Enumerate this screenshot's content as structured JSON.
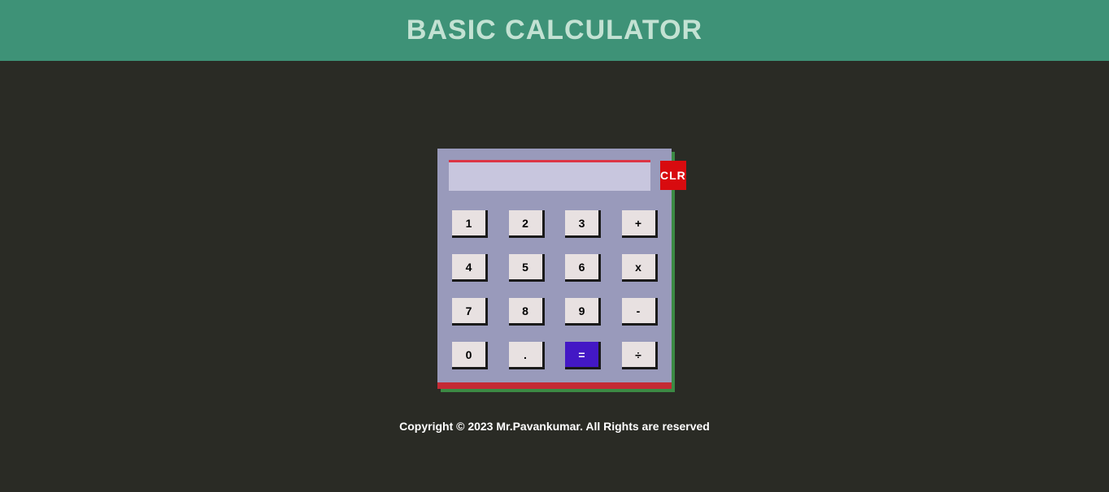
{
  "header": {
    "title": "BASIC CALCULATOR"
  },
  "calculator": {
    "display_value": "",
    "clear_label": "CLR",
    "keys": {
      "k1": "1",
      "k2": "2",
      "k3": "3",
      "plus": "+",
      "k4": "4",
      "k5": "5",
      "k6": "6",
      "mult": "x",
      "k7": "7",
      "k8": "8",
      "k9": "9",
      "minus": "-",
      "k0": "0",
      "dot": ".",
      "eq": "=",
      "div": "÷"
    }
  },
  "footer": {
    "copyright": "Copyright © 2023 Mr.Pavankumar. All Rights are reserved"
  }
}
